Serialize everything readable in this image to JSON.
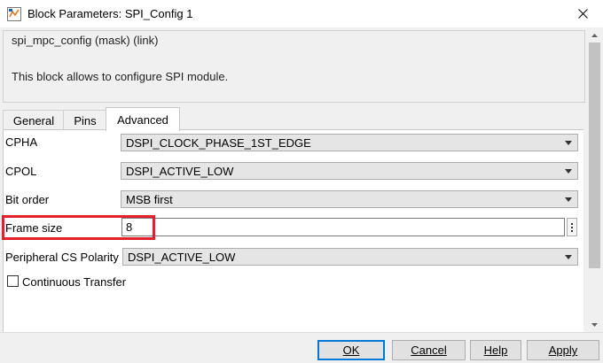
{
  "window": {
    "title": "Block Parameters: SPI_Config 1"
  },
  "header": {
    "title": "spi_mpc_config (mask) (link)",
    "description": "This block allows to configure SPI module."
  },
  "tabs": [
    {
      "label": "General"
    },
    {
      "label": "Pins"
    },
    {
      "label": "Advanced"
    }
  ],
  "active_tab": "Advanced",
  "fields": {
    "cpha": {
      "label": "CPHA",
      "value": "DSPI_CLOCK_PHASE_1ST_EDGE"
    },
    "cpol": {
      "label": "CPOL",
      "value": "DSPI_ACTIVE_LOW"
    },
    "bit_order": {
      "label": "Bit order",
      "value": "MSB first"
    },
    "frame_size": {
      "label": "Frame size",
      "value": "8"
    },
    "cs_polarity": {
      "label": "Peripheral CS Polarity",
      "value": "DSPI_ACTIVE_LOW"
    },
    "continuous_transfer": {
      "label": "Continuous Transfer",
      "checked": false
    }
  },
  "buttons": {
    "ok": "OK",
    "cancel": "Cancel",
    "help": "Help",
    "apply": "Apply"
  },
  "colors": {
    "highlight": "#e3202b",
    "default_button_border": "#0078d7"
  }
}
